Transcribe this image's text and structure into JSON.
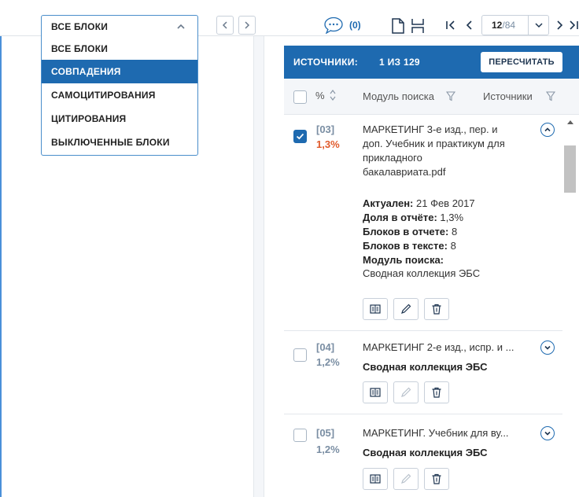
{
  "blocks_filter": {
    "selected": "ВСЕ БЛОКИ",
    "options": [
      "ВСЕ БЛОКИ",
      "СОВПАДЕНИЯ",
      "САМОЦИТИРОВАНИЯ",
      "ЦИТИРОВАНИЯ",
      "ВЫКЛЮЧЕННЫЕ БЛОКИ"
    ],
    "highlighted_option": "СОВПАДЕНИЯ"
  },
  "comments": {
    "count": "(0)"
  },
  "pager": {
    "current": "12",
    "total": "/84"
  },
  "sources": {
    "title": "ИСТОЧНИКИ:",
    "counter": "1 ИЗ 129",
    "recalc_label": "ПЕРЕСЧИТАТЬ",
    "columns": {
      "percent": "%",
      "module": "Модуль поиска",
      "sources": "Источники"
    },
    "items": [
      {
        "num": "[03]",
        "percent": "1,3%",
        "title_lines": [
          "МАРКЕТИНГ 3-е изд., пер. и",
          "доп. Учебник и практикум для",
          "прикладного",
          "бакалавриата.pdf"
        ],
        "actual_label": "Актуален:",
        "actual_value": "21 Фев 2017",
        "share_label": "Доля в отчёте:",
        "share_value": "1,3%",
        "blocks_report_label": "Блоков в отчете:",
        "blocks_report_value": "8",
        "blocks_text_label": "Блоков в тексте:",
        "blocks_text_value": "8",
        "module_label": "Модуль поиска:",
        "module_value": "Сводная коллекция ЭБС"
      },
      {
        "num": "[04]",
        "percent": "1,2%",
        "title": "МАРКЕТИНГ 2-е изд., испр. и ...",
        "module": "Сводная коллекция ЭБС"
      },
      {
        "num": "[05]",
        "percent": "1,2%",
        "title": "МАРКЕТИНГ. Учебник для ву...",
        "module": "Сводная коллекция ЭБС"
      }
    ]
  },
  "colors": {
    "primary": "#1e6ab0",
    "highlight_percent": "#e05a2b",
    "muted": "#7a8ea3"
  }
}
